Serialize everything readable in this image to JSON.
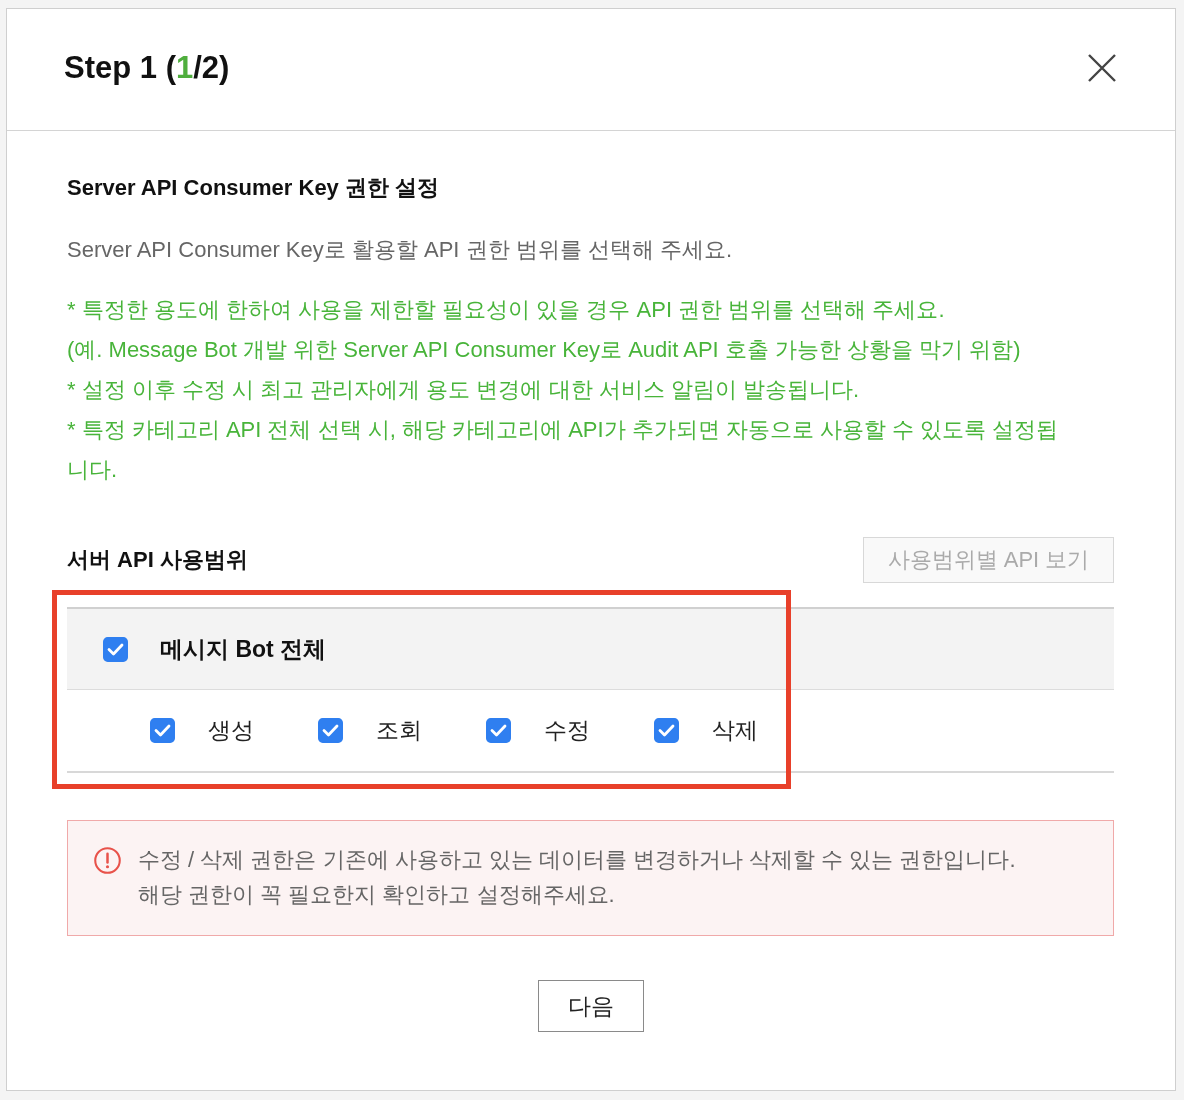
{
  "dialog": {
    "title": {
      "before": "Step 1 (",
      "highlight": "1",
      "after": "/2)"
    }
  },
  "section": {
    "title": "Server API Consumer Key 권한 설정",
    "description": "Server API Consumer Key로 활용할 API 권한 범위를 선택해 주세요.",
    "notes": [
      "* 특정한 용도에 한하여 사용을 제한할 필요성이 있을 경우 API 권한 범위를 선택해 주세요.",
      "(예. Message Bot 개발 위한 Server API Consumer Key로 Audit API 호출 가능한 상황을 막기 위함)",
      "* 설정 이후 수정 시 최고 관리자에게 용도 변경에 대한 서비스 알림이 발송됩니다.",
      "* 특정 카테고리 API 전체 선택 시, 해당 카테고리에 API가 추가되면 자동으로 사용할 수 있도록 설정됩니다."
    ]
  },
  "scope": {
    "title": "서버 API 사용범위",
    "view_button": {
      "label": "사용범위별 API 보기",
      "disabled": true
    },
    "highlighted": true,
    "group": {
      "label": "메시지 Bot 전체",
      "checked": true
    },
    "permissions": [
      {
        "label": "생성",
        "checked": true
      },
      {
        "label": "조회",
        "checked": true
      },
      {
        "label": "수정",
        "checked": true
      },
      {
        "label": "삭제",
        "checked": true
      }
    ]
  },
  "warning": {
    "lines": [
      "수정 / 삭제 권한은 기존에 사용하고 있는 데이터를 변경하거나 삭제할 수 있는 권한입니다.",
      "해당 권한이 꼭 필요한지 확인하고 설정해주세요."
    ]
  },
  "next_button": {
    "label": "다음"
  }
}
